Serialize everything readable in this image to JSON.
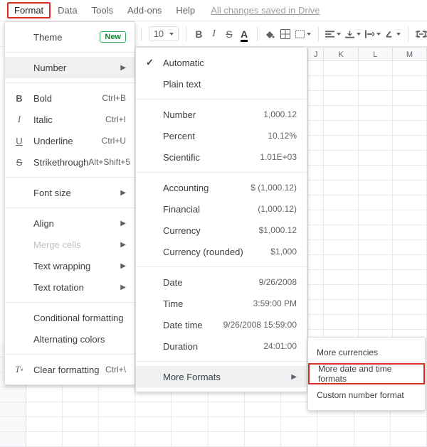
{
  "menubar": {
    "format": "Format",
    "data": "Data",
    "tools": "Tools",
    "addons": "Add-ons",
    "help": "Help",
    "saved": "All changes saved in Drive"
  },
  "toolbar": {
    "font_size": "10"
  },
  "columns": {
    "j": "J",
    "k": "K",
    "l": "L",
    "m": "M"
  },
  "format_menu": {
    "theme": "Theme",
    "new_badge": "New",
    "number": "Number",
    "bold": "Bold",
    "bold_sc": "Ctrl+B",
    "italic": "Italic",
    "italic_sc": "Ctrl+I",
    "underline": "Underline",
    "underline_sc": "Ctrl+U",
    "strike": "Strikethrough",
    "strike_sc": "Alt+Shift+5",
    "font_size": "Font size",
    "align": "Align",
    "merge": "Merge cells",
    "wrap": "Text wrapping",
    "rotation": "Text rotation",
    "cond": "Conditional formatting",
    "alt": "Alternating colors",
    "clear": "Clear formatting",
    "clear_sc": "Ctrl+\\"
  },
  "number_menu": {
    "automatic": "Automatic",
    "plain": "Plain text",
    "number": "Number",
    "number_ex": "1,000.12",
    "percent": "Percent",
    "percent_ex": "10.12%",
    "scientific": "Scientific",
    "scientific_ex": "1.01E+03",
    "accounting": "Accounting",
    "accounting_ex": "$ (1,000.12)",
    "financial": "Financial",
    "financial_ex": "(1,000.12)",
    "currency": "Currency",
    "currency_ex": "$1,000.12",
    "currency_r": "Currency (rounded)",
    "currency_r_ex": "$1,000",
    "date": "Date",
    "date_ex": "9/26/2008",
    "time": "Time",
    "time_ex": "3:59:00 PM",
    "datetime": "Date time",
    "datetime_ex": "9/26/2008 15:59:00",
    "duration": "Duration",
    "duration_ex": "24:01:00",
    "more": "More Formats"
  },
  "more_menu": {
    "currencies": "More currencies",
    "datefmt": "More date and time formats",
    "custom": "Custom number format"
  }
}
